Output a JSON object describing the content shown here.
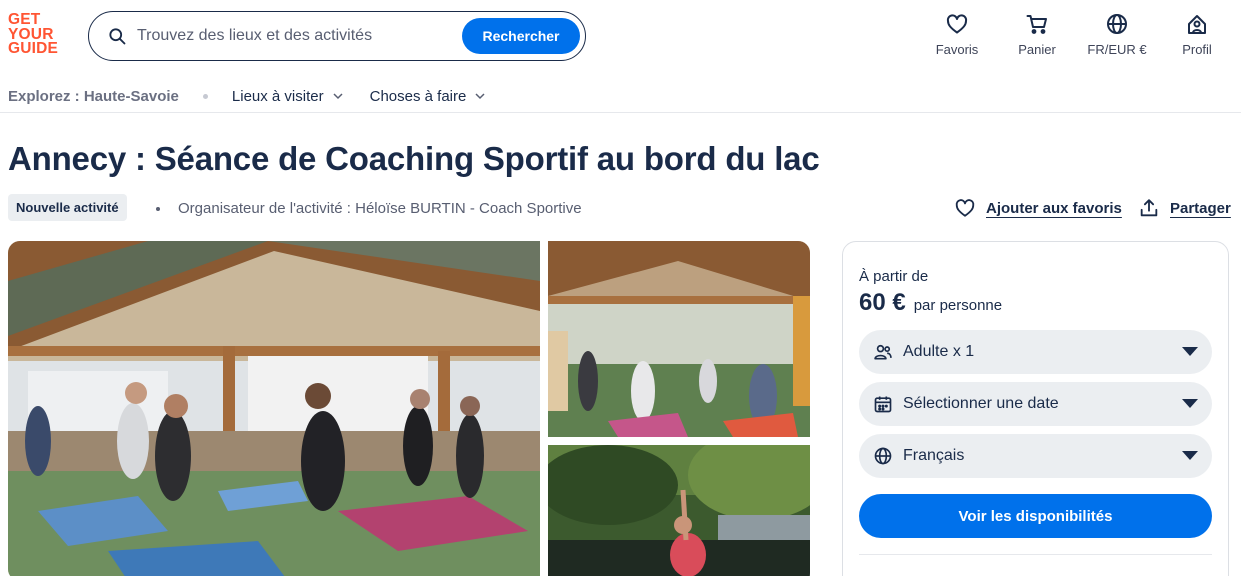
{
  "logo": {
    "line1": "GET",
    "line2": "YOUR",
    "line3": "GUIDE"
  },
  "search": {
    "placeholder": "Trouvez des lieux et des activités",
    "button_label": "Rechercher"
  },
  "header_nav": [
    {
      "label": "Favoris",
      "icon": "heart-icon"
    },
    {
      "label": "Panier",
      "icon": "cart-icon"
    },
    {
      "label": "FR/EUR €",
      "icon": "globe-icon"
    },
    {
      "label": "Profil",
      "icon": "profile-icon"
    }
  ],
  "subnav": {
    "explore": "Explorez : Haute-Savoie",
    "menus": [
      "Lieux à visiter",
      "Choses à faire"
    ]
  },
  "activity": {
    "title": "Annecy : Séance de Coaching Sportif au bord du lac",
    "badge": "Nouvelle activité",
    "organizer": "Organisateur de l'activité : Héloïse BURTIN - Coach Sportive",
    "add_favorite": "Ajouter aux favoris",
    "share": "Partager"
  },
  "booking": {
    "from_label": "À partir de",
    "price": "60 €",
    "per_person": "par personne",
    "participants": "Adulte x 1",
    "date": "Sélectionner une date",
    "language": "Français",
    "cta": "Voir les disponibilités"
  },
  "colors": {
    "brand_orange": "#ff5533",
    "primary_blue": "#0071eb",
    "text_navy": "#1a2b49"
  }
}
